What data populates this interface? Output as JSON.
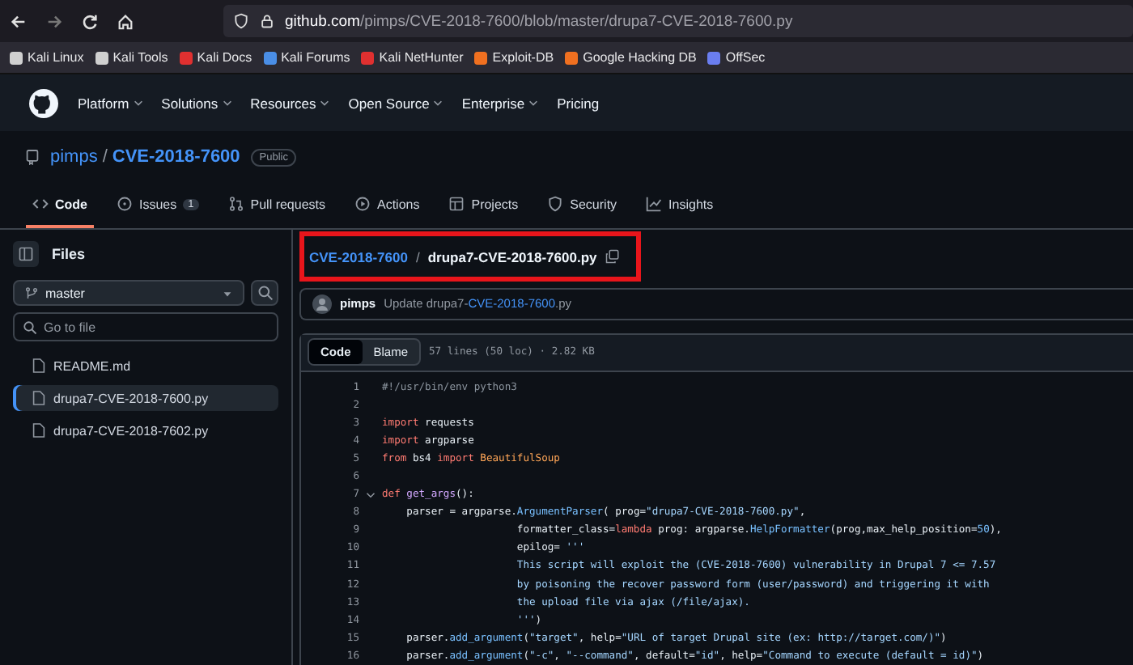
{
  "browser": {
    "url_host": "github.com",
    "url_path": "/pimps/CVE-2018-7600/blob/master/drupa7-CVE-2018-7600.py"
  },
  "bookmarks": [
    {
      "label": "Kali Linux",
      "color": "#d0d0d0"
    },
    {
      "label": "Kali Tools",
      "color": "#d0d0d0"
    },
    {
      "label": "Kali Docs",
      "color": "#e03030"
    },
    {
      "label": "Kali Forums",
      "color": "#4a8ee6"
    },
    {
      "label": "Kali NetHunter",
      "color": "#e03030"
    },
    {
      "label": "Exploit-DB",
      "color": "#f07020"
    },
    {
      "label": "Google Hacking DB",
      "color": "#f07020"
    },
    {
      "label": "OffSec",
      "color": "#6a7ef0"
    }
  ],
  "header": {
    "nav": [
      {
        "label": "Platform",
        "dropdown": true
      },
      {
        "label": "Solutions",
        "dropdown": true
      },
      {
        "label": "Resources",
        "dropdown": true
      },
      {
        "label": "Open Source",
        "dropdown": true
      },
      {
        "label": "Enterprise",
        "dropdown": true
      },
      {
        "label": "Pricing",
        "dropdown": false
      }
    ]
  },
  "repo": {
    "owner": "pimps",
    "separator": "/",
    "name": "CVE-2018-7600",
    "visibility": "Public"
  },
  "tabs": [
    {
      "label": "Code",
      "selected": true
    },
    {
      "label": "Issues",
      "count": "1",
      "selected": false
    },
    {
      "label": "Pull requests",
      "selected": false
    },
    {
      "label": "Actions",
      "selected": false
    },
    {
      "label": "Projects",
      "selected": false
    },
    {
      "label": "Security",
      "selected": false
    },
    {
      "label": "Insights",
      "selected": false
    }
  ],
  "sidebar": {
    "title": "Files",
    "branch": "master",
    "search_placeholder": "Go to file",
    "files": [
      {
        "name": "README.md",
        "selected": false
      },
      {
        "name": "drupa7-CVE-2018-7600.py",
        "selected": true
      },
      {
        "name": "drupa7-CVE-2018-7602.py",
        "selected": false
      }
    ]
  },
  "breadcrumb": {
    "repo": "CVE-2018-7600",
    "separator": "/",
    "file": "drupa7-CVE-2018-7600.py",
    "highlighted": true
  },
  "commit": {
    "author": "pimps",
    "message": [
      {
        "text": "Update drupa7-",
        "link": false
      },
      {
        "text": "CVE-2018-7600",
        "link": true
      },
      {
        "text": ".py",
        "link": false
      }
    ]
  },
  "code_view": {
    "modes": [
      {
        "label": "Code",
        "selected": true
      },
      {
        "label": "Blame",
        "selected": false
      }
    ],
    "info": "57 lines (50 loc) · 2.82 KB",
    "lines": [
      {
        "number": "1",
        "tokens": [
          {
            "kind": "comment",
            "text": "#!/usr/bin/env python3"
          }
        ]
      },
      {
        "number": "2"
      },
      {
        "number": "3",
        "tokens": [
          {
            "kind": "keyword",
            "text": "import"
          },
          {
            "kind": "plain",
            "text": " requests"
          }
        ]
      },
      {
        "number": "4",
        "tokens": [
          {
            "kind": "keyword",
            "text": "import"
          },
          {
            "kind": "plain",
            "text": " argparse"
          }
        ]
      },
      {
        "number": "5",
        "tokens": [
          {
            "kind": "keyword",
            "text": "from"
          },
          {
            "kind": "plain",
            "text": " bs4 "
          },
          {
            "kind": "keyword",
            "text": "import"
          },
          {
            "kind": "class",
            "text": " BeautifulSoup"
          }
        ]
      },
      {
        "number": "6"
      },
      {
        "number": "7",
        "fold": true,
        "tokens": [
          {
            "kind": "keyword",
            "text": "def"
          },
          {
            "kind": "function",
            "text": " get_args"
          },
          {
            "kind": "plain",
            "text": "():"
          }
        ]
      },
      {
        "number": "8",
        "tokens": [
          {
            "kind": "plain",
            "text": "    parser = argparse."
          },
          {
            "kind": "attribute",
            "text": "ArgumentParser"
          },
          {
            "kind": "plain",
            "text": "( prog="
          },
          {
            "kind": "string",
            "text": "\"drupa7-CVE-2018-7600.py\""
          },
          {
            "kind": "plain",
            "text": ","
          }
        ]
      },
      {
        "number": "9",
        "tokens": [
          {
            "kind": "plain",
            "text": "                      formatter_class="
          },
          {
            "kind": "keyword",
            "text": "lambda"
          },
          {
            "kind": "plain",
            "text": " prog: argparse."
          },
          {
            "kind": "attribute",
            "text": "HelpFormatter"
          },
          {
            "kind": "plain",
            "text": "(prog,max_help_position="
          },
          {
            "kind": "attribute",
            "text": "50"
          },
          {
            "kind": "plain",
            "text": "),"
          }
        ]
      },
      {
        "number": "10",
        "tokens": [
          {
            "kind": "plain",
            "text": "                      epilog= "
          },
          {
            "kind": "string",
            "text": "'''"
          }
        ]
      },
      {
        "number": "11",
        "tokens": [
          {
            "kind": "string",
            "text": "                      This script will exploit the (CVE-2018-7600) vulnerability in Drupal 7 <= 7.57"
          }
        ]
      },
      {
        "number": "12",
        "tokens": [
          {
            "kind": "string",
            "text": "                      by poisoning the recover password form (user/password) and triggering it with"
          }
        ]
      },
      {
        "number": "13",
        "tokens": [
          {
            "kind": "string",
            "text": "                      the upload file via ajax (/file/ajax)."
          }
        ]
      },
      {
        "number": "14",
        "tokens": [
          {
            "kind": "string",
            "text": "                      '''"
          },
          {
            "kind": "plain",
            "text": ")"
          }
        ]
      },
      {
        "number": "15",
        "tokens": [
          {
            "kind": "plain",
            "text": "    parser."
          },
          {
            "kind": "attribute",
            "text": "add_argument"
          },
          {
            "kind": "plain",
            "text": "("
          },
          {
            "kind": "string",
            "text": "\"target\""
          },
          {
            "kind": "plain",
            "text": ", help="
          },
          {
            "kind": "string",
            "text": "\"URL of target Drupal site (ex: http://target.com/)\""
          },
          {
            "kind": "plain",
            "text": ")"
          }
        ]
      },
      {
        "number": "16",
        "tokens": [
          {
            "kind": "plain",
            "text": "    parser."
          },
          {
            "kind": "attribute",
            "text": "add_argument"
          },
          {
            "kind": "plain",
            "text": "("
          },
          {
            "kind": "string",
            "text": "\"-c\""
          },
          {
            "kind": "plain",
            "text": ", "
          },
          {
            "kind": "string",
            "text": "\"--command\""
          },
          {
            "kind": "plain",
            "text": ", default="
          },
          {
            "kind": "string",
            "text": "\"id\""
          },
          {
            "kind": "plain",
            "text": ", help="
          },
          {
            "kind": "string",
            "text": "\"Command to execute (default = id)\""
          },
          {
            "kind": "plain",
            "text": ")"
          }
        ]
      }
    ]
  }
}
